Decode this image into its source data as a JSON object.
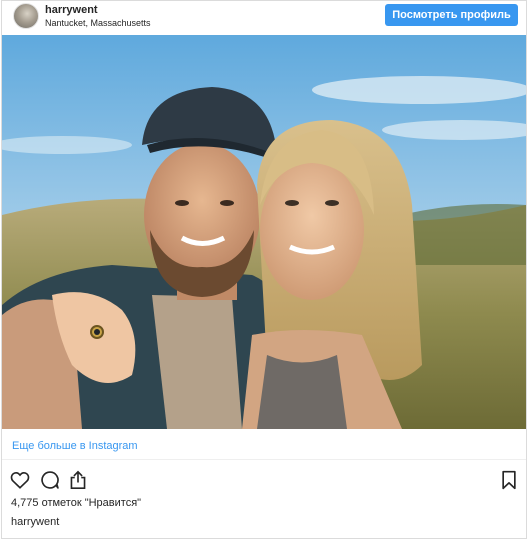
{
  "header": {
    "username": "harrywent",
    "location": "Nantucket, Massachusetts",
    "profile_button": "Посмотреть профиль"
  },
  "photo": {
    "subject": "selfie of couple in dune grass at sunset"
  },
  "more_link": "Еще больше в Instagram",
  "actions": {
    "icons": [
      "heart-icon",
      "comment-icon",
      "share-icon",
      "bookmark-icon"
    ]
  },
  "likes_text": "4,775 отметок \"Нравится\"",
  "caption_user": "harrywent",
  "colors": {
    "accent": "#3897f0",
    "text": "#262626",
    "border": "#dbdbdb"
  }
}
